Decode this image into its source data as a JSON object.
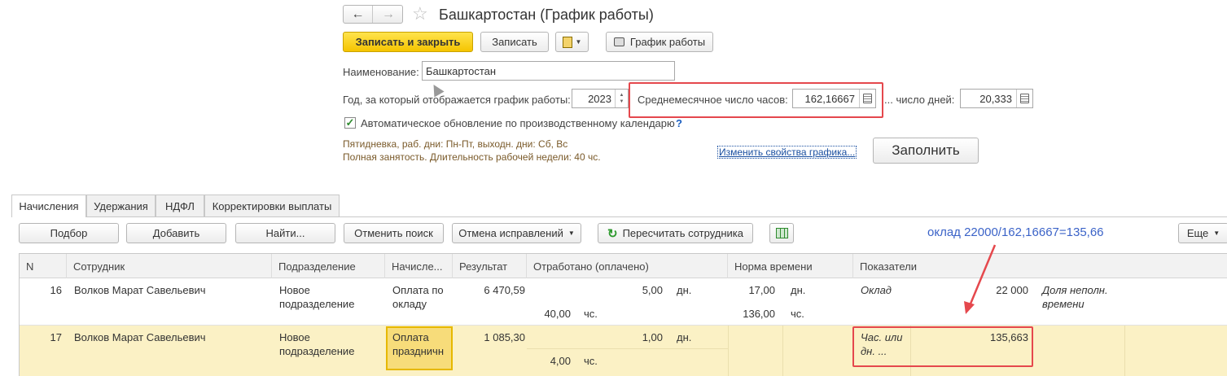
{
  "header": {
    "title": "Башкартостан (График работы)"
  },
  "toolbar": {
    "save_close": "Записать и закрыть",
    "save": "Записать",
    "schedule": "График работы"
  },
  "form": {
    "name_label": "Наименование:",
    "name_value": "Башкартостан",
    "year_label": "Год, за который отображается график работы:",
    "year_value": "2023",
    "avg_hours_label": "Среднемесячное число часов:",
    "avg_hours_value": "162,16667",
    "days_label": "... число дней:",
    "days_value": "20,333",
    "auto_update_label": "Автоматическое обновление по производственному календарю",
    "help": "?",
    "info_line1": "Пятидневка, раб. дни: Пн-Пт, выходн. дни: Сб, Вс",
    "info_line2": "Полная занятость. Длительность рабочей недели: 40 чс.",
    "change_link": "Изменить свойства графика...",
    "fill_button": "Заполнить"
  },
  "tabs": [
    "Начисления",
    "Удержания",
    "НДФЛ",
    "Корректировки выплаты"
  ],
  "grid_toolbar": {
    "pick": "Подбор",
    "add": "Добавить",
    "find": "Найти...",
    "cancel_search": "Отменить поиск",
    "cancel_fixes": "Отмена исправлений",
    "recalc": "Пересчитать сотрудника",
    "more": "Еще"
  },
  "annotation": "оклад 22000/162,16667=135,66",
  "table": {
    "columns": [
      "N",
      "Сотрудник",
      "Подразделение",
      "Начисле...",
      "Результат",
      "Отработано (оплачено)",
      "Норма времени",
      "Показатели"
    ],
    "rows": [
      {
        "n": "16",
        "employee": "Волков Марат Савельевич",
        "dept_line1": "Новое",
        "dept_line2": "подразделение",
        "accrual_line1": "Оплата по",
        "accrual_line2": "окладу",
        "result": "6 470,59",
        "worked_days": "5,00",
        "days_unit": "дн.",
        "worked_hours": "40,00",
        "hours_unit": "чс.",
        "norm_days": "17,00",
        "norm_days_unit": "дн.",
        "norm_hours": "136,00",
        "norm_hours_unit": "чс.",
        "indicator_name": "Оклад",
        "indicator_value": "22 000",
        "extra_line1": "Доля неполн.",
        "extra_line2": "времени"
      },
      {
        "n": "17",
        "employee": "Волков Марат Савельевич",
        "dept_line1": "Новое",
        "dept_line2": "подразделение",
        "accrual_line1": "Оплата",
        "accrual_line2": "праздничн",
        "result": "1 085,30",
        "worked_days": "1,00",
        "days_unit": "дн.",
        "worked_hours": "4,00",
        "hours_unit": "чс.",
        "indicator_name_line1": "Час. или",
        "indicator_name_line2": "дн. ...",
        "indicator_value": "135,663"
      }
    ]
  }
}
